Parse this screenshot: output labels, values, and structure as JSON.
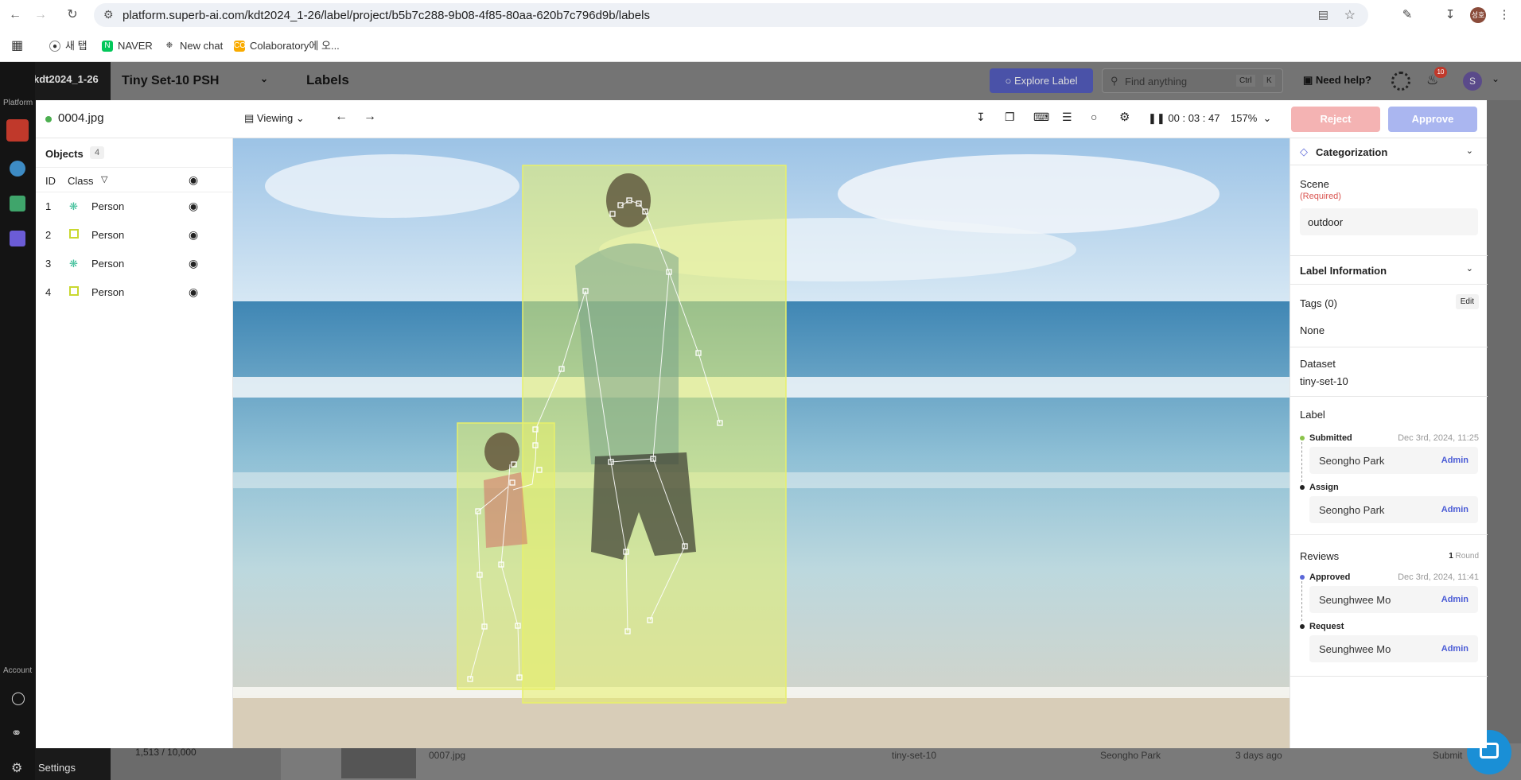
{
  "browser": {
    "url": "platform.superb-ai.com/kdt2024_1-26/label/project/b5b7c288-9b08-4f85-80aa-620b7c796d9b/labels",
    "bookmarks": [
      "새 탭",
      "NAVER",
      "New chat",
      "Colaboratory에 오..."
    ]
  },
  "app": {
    "workspace": "kdt2024_1-26",
    "sidebar_section_platform": "Platform",
    "sidebar_section_account": "Account",
    "settings_label": "Settings",
    "project_name": "Tiny Set-10 PSH",
    "page_title": "Labels",
    "explore_label": "Explore Label",
    "search_placeholder": "Find anything",
    "search_kbd": [
      "Ctrl",
      "K"
    ],
    "need_help": "Need help?",
    "notification_count": "10",
    "avatar_initial": "S",
    "footer_count": "1,513 / 10,000",
    "behind_row": {
      "file": "0007.jpg",
      "dataset": "tiny-set-10",
      "assignee": "Seongho Park",
      "time": "3 days ago",
      "status": "Submit"
    }
  },
  "modal": {
    "filename": "0004.jpg",
    "mode": "Viewing",
    "timer": "00 : 03 : 47",
    "zoom": "157%",
    "reject": "Reject",
    "approve": "Approve",
    "objects_title": "Objects",
    "objects_count": "4",
    "col_id": "ID",
    "col_class": "Class",
    "objects": [
      {
        "id": "1",
        "class": "Person",
        "type": "keypoint"
      },
      {
        "id": "2",
        "class": "Person",
        "type": "box"
      },
      {
        "id": "3",
        "class": "Person",
        "type": "keypoint"
      },
      {
        "id": "4",
        "class": "Person",
        "type": "box"
      }
    ]
  },
  "right_panel": {
    "categorization": "Categorization",
    "scene_label": "Scene",
    "scene_required": "(Required)",
    "scene_value": "outdoor",
    "label_info": "Label Information",
    "tags_label": "Tags (0)",
    "edit": "Edit",
    "tags_value": "None",
    "dataset_label": "Dataset",
    "dataset_value": "tiny-set-10",
    "label_title": "Label",
    "submitted": "Submitted",
    "submitted_date": "Dec 3rd, 2024, 11:25",
    "submitted_by": "Seongho Park",
    "assign": "Assign",
    "assign_by": "Seongho Park",
    "admin": "Admin",
    "reviews": "Reviews",
    "round_num": "1",
    "round_word": "Round",
    "approved": "Approved",
    "approved_date": "Dec 3rd, 2024, 11:41",
    "approved_by": "Seunghwee Mo",
    "request": "Request",
    "request_by": "Seunghwee Mo"
  },
  "colors": {
    "accent": "#5a67d8",
    "box": "#e8f06a",
    "approve": "#aab6f0",
    "reject": "#f4b3b3"
  }
}
